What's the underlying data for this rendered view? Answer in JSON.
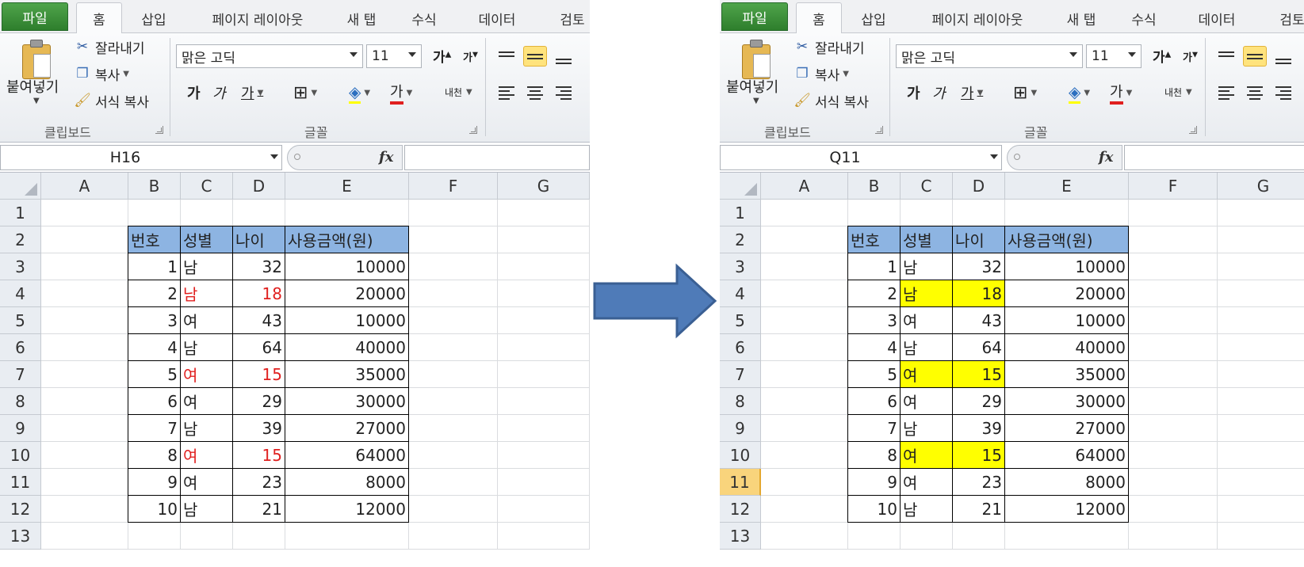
{
  "tabs": {
    "file": "파일",
    "home": "홈",
    "insert": "삽입",
    "page_layout": "페이지 레이아웃",
    "new_tab": "새 탭",
    "formulas": "수식",
    "data": "데이터",
    "review": "검토"
  },
  "ribbon": {
    "paste": "붙여넣기",
    "cut": "잘라내기",
    "copy": "복사",
    "format_painter": "서식 복사",
    "clipboard_group": "클립보드",
    "font_name": "맑은 고딕",
    "font_size": "11",
    "grow_font": "가",
    "shrink_font": "가",
    "bold": "가",
    "italic": "가",
    "underline": "가",
    "font_color_glyph": "가",
    "phonetic": "내천",
    "font_group": "글꼴",
    "fx": "fx"
  },
  "columns": [
    "A",
    "B",
    "C",
    "D",
    "E",
    "F",
    "G"
  ],
  "rows": [
    "1",
    "2",
    "3",
    "4",
    "5",
    "6",
    "7",
    "8",
    "9",
    "10",
    "11",
    "12",
    "13"
  ],
  "table": {
    "headers": [
      "번호",
      "성별",
      "나이",
      "사용금액(원)"
    ],
    "rows": [
      [
        "1",
        "남",
        "32",
        "10000"
      ],
      [
        "2",
        "남",
        "18",
        "20000"
      ],
      [
        "3",
        "여",
        "43",
        "10000"
      ],
      [
        "4",
        "남",
        "64",
        "40000"
      ],
      [
        "5",
        "여",
        "15",
        "35000"
      ],
      [
        "6",
        "여",
        "29",
        "30000"
      ],
      [
        "7",
        "남",
        "39",
        "27000"
      ],
      [
        "8",
        "여",
        "15",
        "64000"
      ],
      [
        "9",
        "여",
        "23",
        "8000"
      ],
      [
        "10",
        "남",
        "21",
        "12000"
      ]
    ]
  },
  "left": {
    "namebox": "H16",
    "emphasis": "red-text",
    "emphasized_rows": [
      2,
      5,
      8
    ]
  },
  "right": {
    "namebox": "Q11",
    "emphasis": "yellow-fill",
    "emphasized_rows": [
      2,
      5,
      8
    ],
    "selected_row": "11"
  },
  "colors": {
    "header_fill": "#8db4e2",
    "highlight_fill": "#ffff00",
    "emphasis_text": "#e0201f",
    "file_tab": "#3c8f39",
    "arrow_fill": "#4f7bb8"
  }
}
